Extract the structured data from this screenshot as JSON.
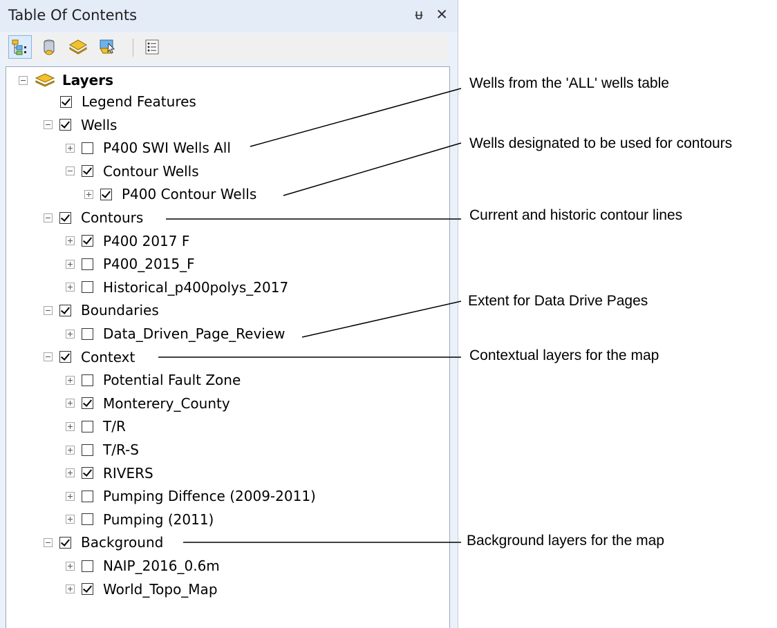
{
  "window": {
    "title": "Table Of Contents",
    "pin_glyph": "ᵾ",
    "close_glyph": "✕"
  },
  "toolbar": {
    "buttons": [
      {
        "name": "list-by-drawing-order",
        "icon": "list-by-drawing-order-icon"
      },
      {
        "name": "list-by-source",
        "icon": "database-icon"
      },
      {
        "name": "list-by-visibility",
        "icon": "layers-icon"
      },
      {
        "name": "list-by-selection",
        "icon": "selection-icon"
      },
      {
        "name": "options",
        "icon": "options-list-icon"
      }
    ]
  },
  "tree": {
    "root": {
      "label": "Layers",
      "expanded": true
    },
    "items": [
      {
        "label": "Legend Features",
        "checked": true,
        "expander": "none",
        "level": 1
      },
      {
        "label": "Wells",
        "checked": true,
        "expander": "minus",
        "level": 1
      },
      {
        "label": "P400 SWI Wells All",
        "checked": false,
        "expander": "plus",
        "level": 2
      },
      {
        "label": "Contour Wells",
        "checked": true,
        "expander": "minus",
        "level": 2
      },
      {
        "label": "P400 Contour Wells",
        "checked": true,
        "expander": "plus",
        "level": 3
      },
      {
        "label": "Contours",
        "checked": true,
        "expander": "minus",
        "level": 1
      },
      {
        "label": "P400 2017 F",
        "checked": true,
        "expander": "plus",
        "level": 2
      },
      {
        "label": "P400_2015_F",
        "checked": false,
        "expander": "plus",
        "level": 2
      },
      {
        "label": "Historical_p400polys_2017",
        "checked": false,
        "expander": "plus",
        "level": 2
      },
      {
        "label": "Boundaries",
        "checked": true,
        "expander": "minus",
        "level": 1
      },
      {
        "label": "Data_Driven_Page_Review",
        "checked": false,
        "expander": "plus",
        "level": 2
      },
      {
        "label": "Context",
        "checked": true,
        "expander": "minus",
        "level": 1
      },
      {
        "label": "Potential Fault Zone",
        "checked": false,
        "expander": "plus",
        "level": 2
      },
      {
        "label": "Monterery_County",
        "checked": true,
        "expander": "plus",
        "level": 2
      },
      {
        "label": "T/R",
        "checked": false,
        "expander": "plus",
        "level": 2
      },
      {
        "label": "T/R-S",
        "checked": false,
        "expander": "plus",
        "level": 2
      },
      {
        "label": "RIVERS",
        "checked": true,
        "expander": "plus",
        "level": 2
      },
      {
        "label": "Pumping Diffence (2009-2011)",
        "checked": false,
        "expander": "plus",
        "level": 2
      },
      {
        "label": "Pumping (2011)",
        "checked": false,
        "expander": "plus",
        "level": 2
      },
      {
        "label": "Background",
        "checked": true,
        "expander": "minus",
        "level": 1
      },
      {
        "label": "NAIP_2016_0.6m",
        "checked": false,
        "expander": "plus",
        "level": 2
      },
      {
        "label": "World_Topo_Map",
        "checked": true,
        "expander": "plus",
        "level": 2
      }
    ]
  },
  "annotations": [
    {
      "text": "Wells from the 'ALL' wells table"
    },
    {
      "text": "Wells designated to be used for contours"
    },
    {
      "text": "Current and historic contour lines"
    },
    {
      "text": "Extent for Data Drive Pages"
    },
    {
      "text": "Contextual layers for the map"
    },
    {
      "text": "Background layers for the map"
    }
  ],
  "colors": {
    "panel_bg": "#eaf1fa",
    "tree_bg": "#ffffff",
    "active_button_border": "#7eb4ea",
    "layers_icon_yellow": "#f2c12e"
  }
}
